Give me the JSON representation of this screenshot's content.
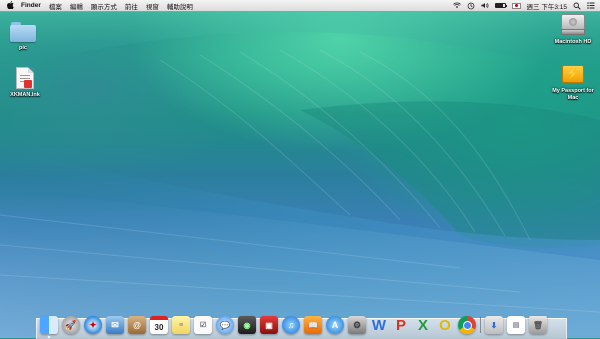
{
  "menubar": {
    "apple": "",
    "app_name": "Finder",
    "menus": [
      "檔案",
      "編輯",
      "顯示方式",
      "前往",
      "視窗",
      "輔助說明"
    ],
    "clock": "週三 下午3:15",
    "battery_level": 0.85,
    "status_icons": [
      "wifi-icon",
      "time-machine-icon",
      "volume-icon",
      "battery-icon",
      "input-flag-icon",
      "spotlight-icon",
      "notification-center-icon"
    ]
  },
  "desktop": {
    "left_items": [
      {
        "label": "pic",
        "icon": "folder-icon"
      },
      {
        "label": "XKMAN.lnk",
        "icon": "document-icon"
      }
    ],
    "right_items": [
      {
        "label": "Macintosh HD",
        "icon": "hard-drive-icon"
      },
      {
        "label": "My Passport for Mac",
        "icon": "external-drive-icon"
      }
    ]
  },
  "dock": {
    "calendar_day": "30",
    "apps": [
      "finder",
      "launchpad",
      "safari",
      "mail",
      "contacts",
      "calendar",
      "notes",
      "reminders",
      "messages",
      "facetime",
      "photo-booth",
      "itunes",
      "ibooks",
      "app-store",
      "system-preferences",
      "word",
      "powerpoint",
      "excel",
      "outlook",
      "chrome"
    ],
    "right_items": [
      "downloads",
      "document-stack",
      "trash"
    ]
  }
}
